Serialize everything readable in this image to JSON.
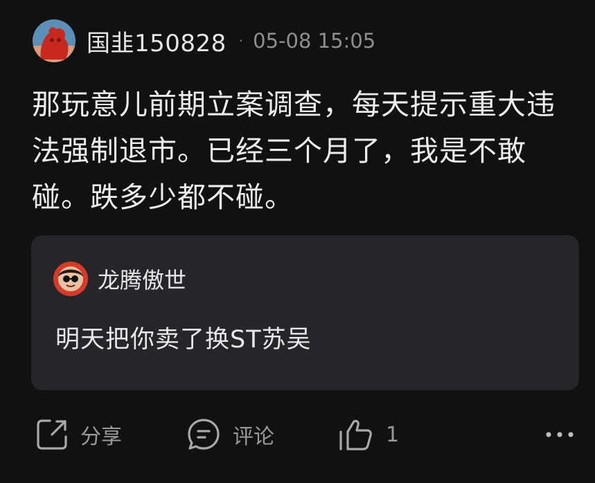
{
  "post": {
    "author": "国韭150828",
    "separator": "·",
    "timestamp": "05-08 15:05",
    "content": "那玩意儿前期立案调查，每天提示重大违法强制退市。已经三个月了，我是不敢碰。跌多少都不碰。"
  },
  "quote": {
    "author": "龙腾傲世",
    "text": "明天把你卖了换ST苏吴"
  },
  "actions": {
    "share_label": "分享",
    "comment_label": "评论",
    "like_count": "1"
  },
  "icons": {
    "share": "share-icon",
    "comment": "comment-icon",
    "like": "thumbs-up-icon",
    "more": "more-icon"
  },
  "colors": {
    "background": "#111111",
    "quote_background": "#262628",
    "muted_text": "#8e8e8e"
  }
}
